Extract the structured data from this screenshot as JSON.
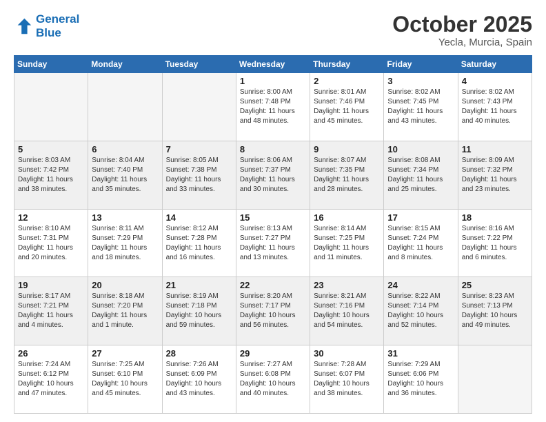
{
  "header": {
    "logo_line1": "General",
    "logo_line2": "Blue",
    "month": "October 2025",
    "location": "Yecla, Murcia, Spain"
  },
  "days_of_week": [
    "Sunday",
    "Monday",
    "Tuesday",
    "Wednesday",
    "Thursday",
    "Friday",
    "Saturday"
  ],
  "weeks": [
    [
      {
        "num": "",
        "info": ""
      },
      {
        "num": "",
        "info": ""
      },
      {
        "num": "",
        "info": ""
      },
      {
        "num": "1",
        "info": "Sunrise: 8:00 AM\nSunset: 7:48 PM\nDaylight: 11 hours\nand 48 minutes."
      },
      {
        "num": "2",
        "info": "Sunrise: 8:01 AM\nSunset: 7:46 PM\nDaylight: 11 hours\nand 45 minutes."
      },
      {
        "num": "3",
        "info": "Sunrise: 8:02 AM\nSunset: 7:45 PM\nDaylight: 11 hours\nand 43 minutes."
      },
      {
        "num": "4",
        "info": "Sunrise: 8:02 AM\nSunset: 7:43 PM\nDaylight: 11 hours\nand 40 minutes."
      }
    ],
    [
      {
        "num": "5",
        "info": "Sunrise: 8:03 AM\nSunset: 7:42 PM\nDaylight: 11 hours\nand 38 minutes."
      },
      {
        "num": "6",
        "info": "Sunrise: 8:04 AM\nSunset: 7:40 PM\nDaylight: 11 hours\nand 35 minutes."
      },
      {
        "num": "7",
        "info": "Sunrise: 8:05 AM\nSunset: 7:38 PM\nDaylight: 11 hours\nand 33 minutes."
      },
      {
        "num": "8",
        "info": "Sunrise: 8:06 AM\nSunset: 7:37 PM\nDaylight: 11 hours\nand 30 minutes."
      },
      {
        "num": "9",
        "info": "Sunrise: 8:07 AM\nSunset: 7:35 PM\nDaylight: 11 hours\nand 28 minutes."
      },
      {
        "num": "10",
        "info": "Sunrise: 8:08 AM\nSunset: 7:34 PM\nDaylight: 11 hours\nand 25 minutes."
      },
      {
        "num": "11",
        "info": "Sunrise: 8:09 AM\nSunset: 7:32 PM\nDaylight: 11 hours\nand 23 minutes."
      }
    ],
    [
      {
        "num": "12",
        "info": "Sunrise: 8:10 AM\nSunset: 7:31 PM\nDaylight: 11 hours\nand 20 minutes."
      },
      {
        "num": "13",
        "info": "Sunrise: 8:11 AM\nSunset: 7:29 PM\nDaylight: 11 hours\nand 18 minutes."
      },
      {
        "num": "14",
        "info": "Sunrise: 8:12 AM\nSunset: 7:28 PM\nDaylight: 11 hours\nand 16 minutes."
      },
      {
        "num": "15",
        "info": "Sunrise: 8:13 AM\nSunset: 7:27 PM\nDaylight: 11 hours\nand 13 minutes."
      },
      {
        "num": "16",
        "info": "Sunrise: 8:14 AM\nSunset: 7:25 PM\nDaylight: 11 hours\nand 11 minutes."
      },
      {
        "num": "17",
        "info": "Sunrise: 8:15 AM\nSunset: 7:24 PM\nDaylight: 11 hours\nand 8 minutes."
      },
      {
        "num": "18",
        "info": "Sunrise: 8:16 AM\nSunset: 7:22 PM\nDaylight: 11 hours\nand 6 minutes."
      }
    ],
    [
      {
        "num": "19",
        "info": "Sunrise: 8:17 AM\nSunset: 7:21 PM\nDaylight: 11 hours\nand 4 minutes."
      },
      {
        "num": "20",
        "info": "Sunrise: 8:18 AM\nSunset: 7:20 PM\nDaylight: 11 hours\nand 1 minute."
      },
      {
        "num": "21",
        "info": "Sunrise: 8:19 AM\nSunset: 7:18 PM\nDaylight: 10 hours\nand 59 minutes."
      },
      {
        "num": "22",
        "info": "Sunrise: 8:20 AM\nSunset: 7:17 PM\nDaylight: 10 hours\nand 56 minutes."
      },
      {
        "num": "23",
        "info": "Sunrise: 8:21 AM\nSunset: 7:16 PM\nDaylight: 10 hours\nand 54 minutes."
      },
      {
        "num": "24",
        "info": "Sunrise: 8:22 AM\nSunset: 7:14 PM\nDaylight: 10 hours\nand 52 minutes."
      },
      {
        "num": "25",
        "info": "Sunrise: 8:23 AM\nSunset: 7:13 PM\nDaylight: 10 hours\nand 49 minutes."
      }
    ],
    [
      {
        "num": "26",
        "info": "Sunrise: 7:24 AM\nSunset: 6:12 PM\nDaylight: 10 hours\nand 47 minutes."
      },
      {
        "num": "27",
        "info": "Sunrise: 7:25 AM\nSunset: 6:10 PM\nDaylight: 10 hours\nand 45 minutes."
      },
      {
        "num": "28",
        "info": "Sunrise: 7:26 AM\nSunset: 6:09 PM\nDaylight: 10 hours\nand 43 minutes."
      },
      {
        "num": "29",
        "info": "Sunrise: 7:27 AM\nSunset: 6:08 PM\nDaylight: 10 hours\nand 40 minutes."
      },
      {
        "num": "30",
        "info": "Sunrise: 7:28 AM\nSunset: 6:07 PM\nDaylight: 10 hours\nand 38 minutes."
      },
      {
        "num": "31",
        "info": "Sunrise: 7:29 AM\nSunset: 6:06 PM\nDaylight: 10 hours\nand 36 minutes."
      },
      {
        "num": "",
        "info": ""
      }
    ]
  ]
}
